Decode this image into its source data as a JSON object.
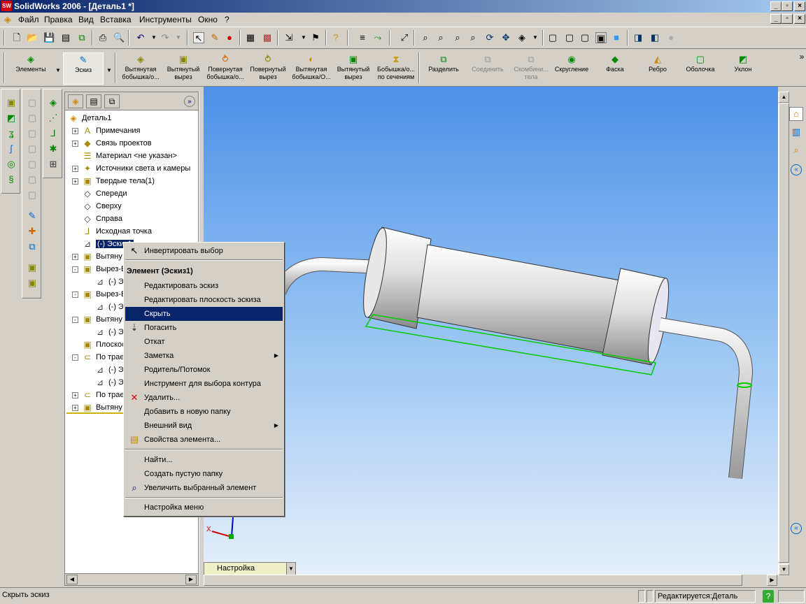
{
  "window": {
    "title": "SolidWorks 2006 - [Деталь1 *]",
    "logo": "SW",
    "controls": [
      "_",
      "▫",
      "×"
    ],
    "doc_controls": [
      "_",
      "▫",
      "×"
    ]
  },
  "menu": [
    "Файл",
    "Правка",
    "Вид",
    "Вставка",
    "Инструменты",
    "Окно",
    "?"
  ],
  "feature_toolbar": {
    "mode_elements": "Элементы",
    "mode_sketch": "Эскиз",
    "buttons": [
      {
        "label": "Вытянутая бобышка/о...",
        "icon": "extrude-boss-icon"
      },
      {
        "label": "Вытянутый вырез",
        "icon": "extrude-cut-icon"
      },
      {
        "label": "Повернутая бобышка/о...",
        "icon": "revolve-boss-icon"
      },
      {
        "label": "Повернутый вырез",
        "icon": "revolve-cut-icon"
      },
      {
        "label": "Вытянутая бобышка/О...",
        "icon": "sweep-boss-icon"
      },
      {
        "label": "Вытянутый вырез",
        "icon": "sweep-cut-icon"
      },
      {
        "label": "Бобышка/о... по сечениям",
        "icon": "loft-icon"
      },
      {
        "label": "Разделить",
        "icon": "split-icon"
      },
      {
        "label": "Соединить",
        "icon": "join-icon"
      },
      {
        "label": "Скомбини... тела",
        "icon": "combine-icon"
      },
      {
        "label": "Скругление",
        "icon": "fillet-icon"
      },
      {
        "label": "Фаска",
        "icon": "chamfer-icon"
      },
      {
        "label": "Ребро",
        "icon": "rib-icon"
      },
      {
        "label": "Оболочка",
        "icon": "shell-icon"
      },
      {
        "label": "Уклон",
        "icon": "draft-icon"
      }
    ]
  },
  "tree": {
    "root": "Деталь1",
    "items": [
      {
        "label": "Примечания",
        "exp": "+"
      },
      {
        "label": "Связь проектов",
        "exp": "+"
      },
      {
        "label": "Материал <не указан>",
        "exp": ""
      },
      {
        "label": "Источники света и камеры",
        "exp": "+"
      },
      {
        "label": "Твердые тела(1)",
        "exp": "+"
      },
      {
        "label": "Спереди",
        "exp": ""
      },
      {
        "label": "Сверху",
        "exp": ""
      },
      {
        "label": "Справа",
        "exp": ""
      },
      {
        "label": "Исходная точка",
        "exp": ""
      },
      {
        "label": "(-) Эскиз1",
        "exp": "",
        "selected": true
      },
      {
        "label": "Вытяну",
        "exp": "+"
      },
      {
        "label": "Вырез-В",
        "exp": "-"
      },
      {
        "label": "(-) Э",
        "exp": "",
        "indent": true
      },
      {
        "label": "Вырез-В",
        "exp": "-"
      },
      {
        "label": "(-) Э",
        "exp": "",
        "indent": true
      },
      {
        "label": "Вытяну",
        "exp": "-"
      },
      {
        "label": "(-) Э",
        "exp": "",
        "indent": true
      },
      {
        "label": "Плоскос",
        "exp": ""
      },
      {
        "label": "По трае",
        "exp": "-"
      },
      {
        "label": "(-) Э",
        "exp": "",
        "indent": true
      },
      {
        "label": "(-) Э",
        "exp": "",
        "indent": true
      },
      {
        "label": "По трае",
        "exp": "+"
      },
      {
        "label": "Вытяну",
        "exp": "+"
      }
    ]
  },
  "context_menu": {
    "top_item": "Инвертировать выбор",
    "header": "Элемент (Эскиз1)",
    "group1": [
      {
        "label": "Редактировать эскиз"
      },
      {
        "label": "Редактировать плоскость эскиза"
      },
      {
        "label": "Скрыть",
        "highlight": true
      },
      {
        "label": "Погасить",
        "icon": "suppress-icon"
      },
      {
        "label": "Откат"
      },
      {
        "label": "Заметка",
        "sub": true
      },
      {
        "label": "Родитель/Потомок"
      },
      {
        "label": "Инструмент для выбора контура"
      },
      {
        "label": "Удалить...",
        "icon": "delete-icon"
      },
      {
        "label": "Добавить в новую папку"
      },
      {
        "label": "Внешний вид",
        "sub": true
      },
      {
        "label": "Свойства элемента...",
        "icon": "properties-icon"
      }
    ],
    "group2": [
      {
        "label": "Найти..."
      },
      {
        "label": "Создать пустую папку"
      },
      {
        "label": "Увеличить выбранный элемент",
        "icon": "zoom-icon"
      }
    ],
    "footer": "Настройка меню"
  },
  "viewport": {
    "config_dropdown": "Настройка",
    "triad_x": "X",
    "triad_y": "Y"
  },
  "status": {
    "left": "Скрыть эскиз",
    "right": "Редактируется:Деталь"
  },
  "colors": {
    "title_start": "#0a246a",
    "title_end": "#a6caf0",
    "selection": "#0a246a",
    "sketch_green": "#00cc00"
  }
}
